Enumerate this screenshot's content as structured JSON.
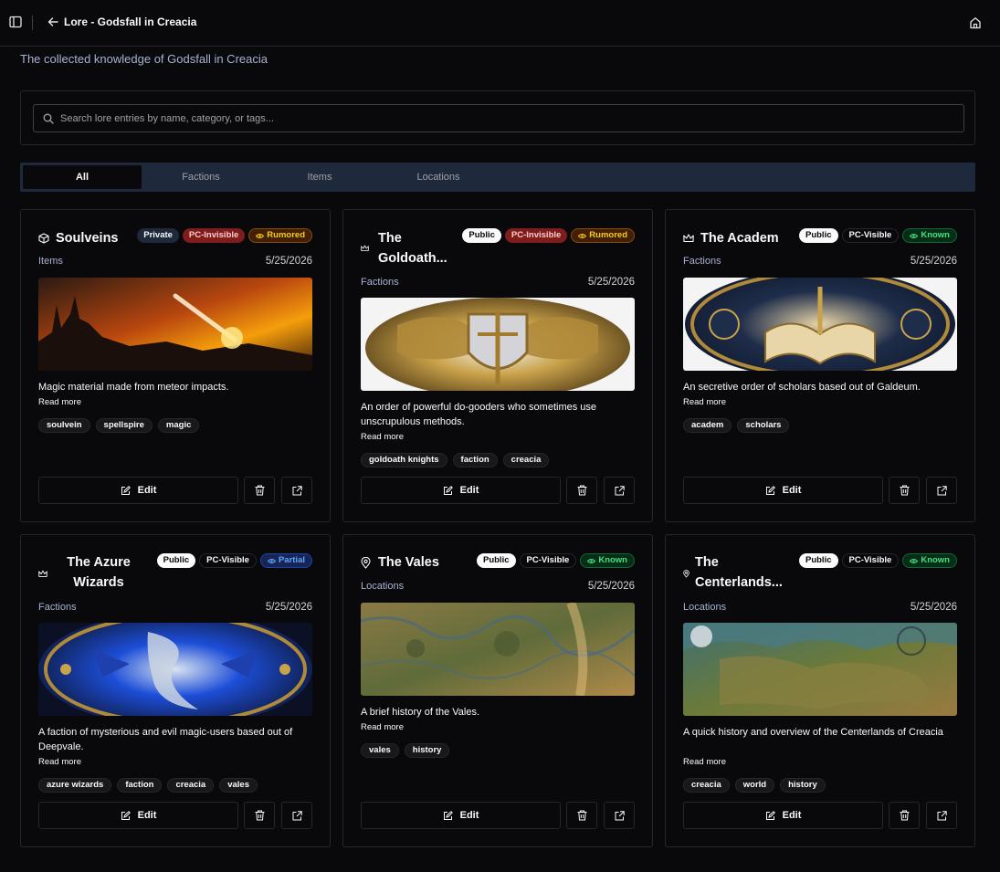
{
  "header": {
    "title": "Lore - Godsfall in Creacia"
  },
  "subtitle": "The collected knowledge of Godsfall in Creacia",
  "search": {
    "placeholder": "Search lore entries by name, category, or tags..."
  },
  "tabs": [
    {
      "label": "All",
      "active": true
    },
    {
      "label": "Factions",
      "active": false
    },
    {
      "label": "Items",
      "active": false
    },
    {
      "label": "Locations",
      "active": false
    }
  ],
  "colors": {
    "background": "#09090b",
    "border": "#27272a",
    "tab_bar": "#1e293b",
    "pc_invisible": "#7f1d1d",
    "rumored": "#facc15",
    "known": "#4ade80",
    "partial": "#60a5fa"
  },
  "cards": [
    {
      "title": "Soulveins",
      "icon": "box-icon",
      "badges": [
        "Private",
        "PC-Invisible",
        "Rumored"
      ],
      "category": "Items",
      "date": "5/25/2026",
      "description": "Magic material made from meteor impacts.",
      "read_more": "Read more",
      "tags": [
        "soulvein",
        "spellspire",
        "magic"
      ],
      "edit_label": "Edit"
    },
    {
      "title": "The Goldoath...",
      "icon": "crown-icon",
      "badges": [
        "Public",
        "PC-Invisible",
        "Rumored"
      ],
      "category": "Factions",
      "date": "5/25/2026",
      "description": "An order of powerful do-gooders who sometimes use unscrupulous methods.",
      "read_more": "Read more",
      "tags": [
        "goldoath knights",
        "faction",
        "creacia"
      ],
      "edit_label": "Edit"
    },
    {
      "title": "The Academ",
      "icon": "crown-icon",
      "badges": [
        "Public",
        "PC-Visible",
        "Known"
      ],
      "category": "Factions",
      "date": "5/25/2026",
      "description": "An secretive order of scholars based out of Galdeum.",
      "read_more": "Read more",
      "tags": [
        "academ",
        "scholars"
      ],
      "edit_label": "Edit"
    },
    {
      "title": "The Azure Wizards",
      "icon": "crown-icon",
      "badges": [
        "Public",
        "PC-Visible",
        "Partial"
      ],
      "category": "Factions",
      "date": "5/25/2026",
      "description": "A faction of mysterious and evil magic-users based out of Deepvale.",
      "read_more": "Read more",
      "tags": [
        "azure wizards",
        "faction",
        "creacia",
        "vales"
      ],
      "edit_label": "Edit"
    },
    {
      "title": "The Vales",
      "icon": "map-pin-icon",
      "badges": [
        "Public",
        "PC-Visible",
        "Known"
      ],
      "category": "Locations",
      "date": "5/25/2026",
      "description": "A brief history of the Vales.",
      "read_more": "Read more",
      "tags": [
        "vales",
        "history"
      ],
      "edit_label": "Edit"
    },
    {
      "title": "The Centerlands...",
      "icon": "map-pin-icon",
      "badges": [
        "Public",
        "PC-Visible",
        "Known"
      ],
      "category": "Locations",
      "date": "5/25/2026",
      "description": "A quick history and overview of the Centerlands of Creacia",
      "read_more": "Read more",
      "tags": [
        "creacia",
        "world",
        "history"
      ],
      "edit_label": "Edit"
    }
  ]
}
